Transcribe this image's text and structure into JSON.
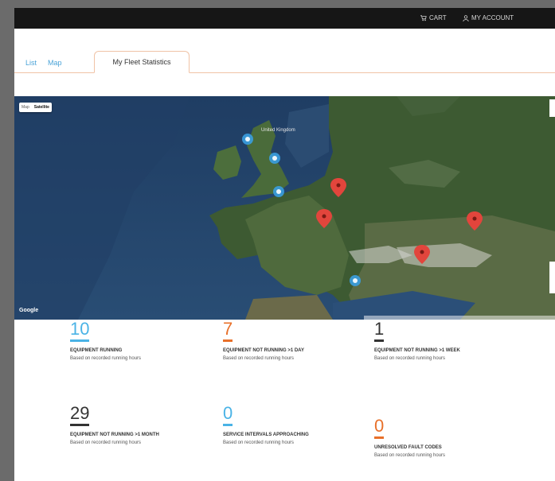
{
  "header": {
    "cart_label": "CART",
    "account_label": "MY ACCOUNT"
  },
  "tabs": {
    "list": "List",
    "map": "Map",
    "fleet": "My Fleet Statistics"
  },
  "map": {
    "toggle": {
      "map": "Map",
      "satellite": "Satellite",
      "selected": "Satellite"
    },
    "attribution": "Google",
    "labels": [
      "United Kingdom"
    ]
  },
  "stats": [
    {
      "value": "10",
      "label": "EQUIPMENT RUNNING",
      "sub": "Based on recorded running hours",
      "color": "#4ab3e6"
    },
    {
      "value": "7",
      "label": "EQUIPMENT NOT RUNNING >1 DAY",
      "sub": "Based on recorded running hours",
      "color": "#e8702a"
    },
    {
      "value": "1",
      "label": "EQUIPMENT NOT RUNNING >1 WEEK",
      "sub": "Based on recorded running hours",
      "color": "#333333"
    },
    {
      "value": "29",
      "label": "EQUIPMENT NOT RUNNING >1 MONTH",
      "sub": "Based on recorded running hours",
      "color": "#333333"
    },
    {
      "value": "0",
      "label": "SERVICE INTERVALS APPROACHING",
      "sub": "Based on recorded running hours",
      "color": "#4ab3e6"
    },
    {
      "value": "0",
      "label": "UNRESOLVED FAULT CODES",
      "sub": "Based on recorded running hours",
      "color": "#e8702a"
    }
  ],
  "colors": {
    "accent_blue": "#4ab3e6",
    "accent_orange": "#e8702a",
    "marker_red": "#e2453c",
    "cluster_blue": "#3a9ee0"
  }
}
